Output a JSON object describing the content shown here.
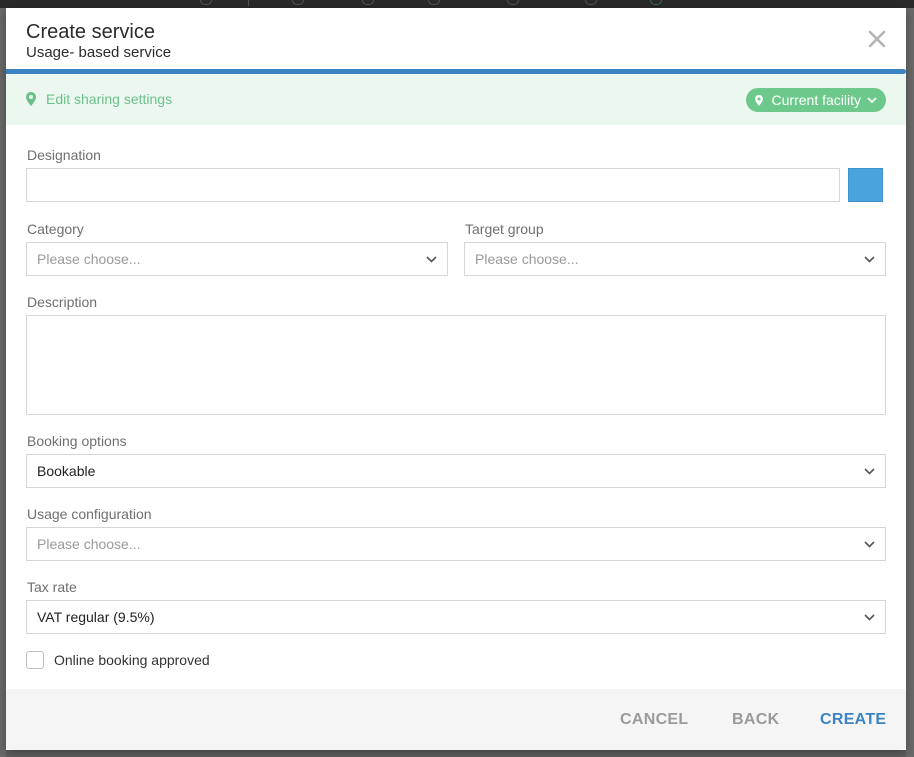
{
  "modal": {
    "title": "Create service",
    "subtitle": "Usage- based service",
    "close_icon": "close-icon",
    "progress_fraction": 1.0,
    "accent_color": "#3b84c4"
  },
  "sharing": {
    "link_label": "Edit sharing settings",
    "link_icon": "map-pin-icon",
    "facility_label": "Current facility",
    "facility_icon": "map-pin-icon",
    "color": "#6cc98b"
  },
  "form": {
    "designation": {
      "label": "Designation",
      "value": "",
      "color": "#4aa3dc"
    },
    "category": {
      "label": "Category",
      "placeholder": "Please choose..."
    },
    "target_group": {
      "label": "Target group",
      "placeholder": "Please choose..."
    },
    "description": {
      "label": "Description",
      "value": ""
    },
    "booking_options": {
      "label": "Booking options",
      "value": "Bookable"
    },
    "usage_configuration": {
      "label": "Usage configuration",
      "placeholder": "Please choose..."
    },
    "tax_rate": {
      "label": "Tax rate",
      "value": "VAT regular (9.5%)"
    },
    "online_booking": {
      "label": "Online booking approved",
      "checked": false
    }
  },
  "footer": {
    "cancel_label": "CANCEL",
    "back_label": "BACK",
    "create_label": "CREATE"
  }
}
